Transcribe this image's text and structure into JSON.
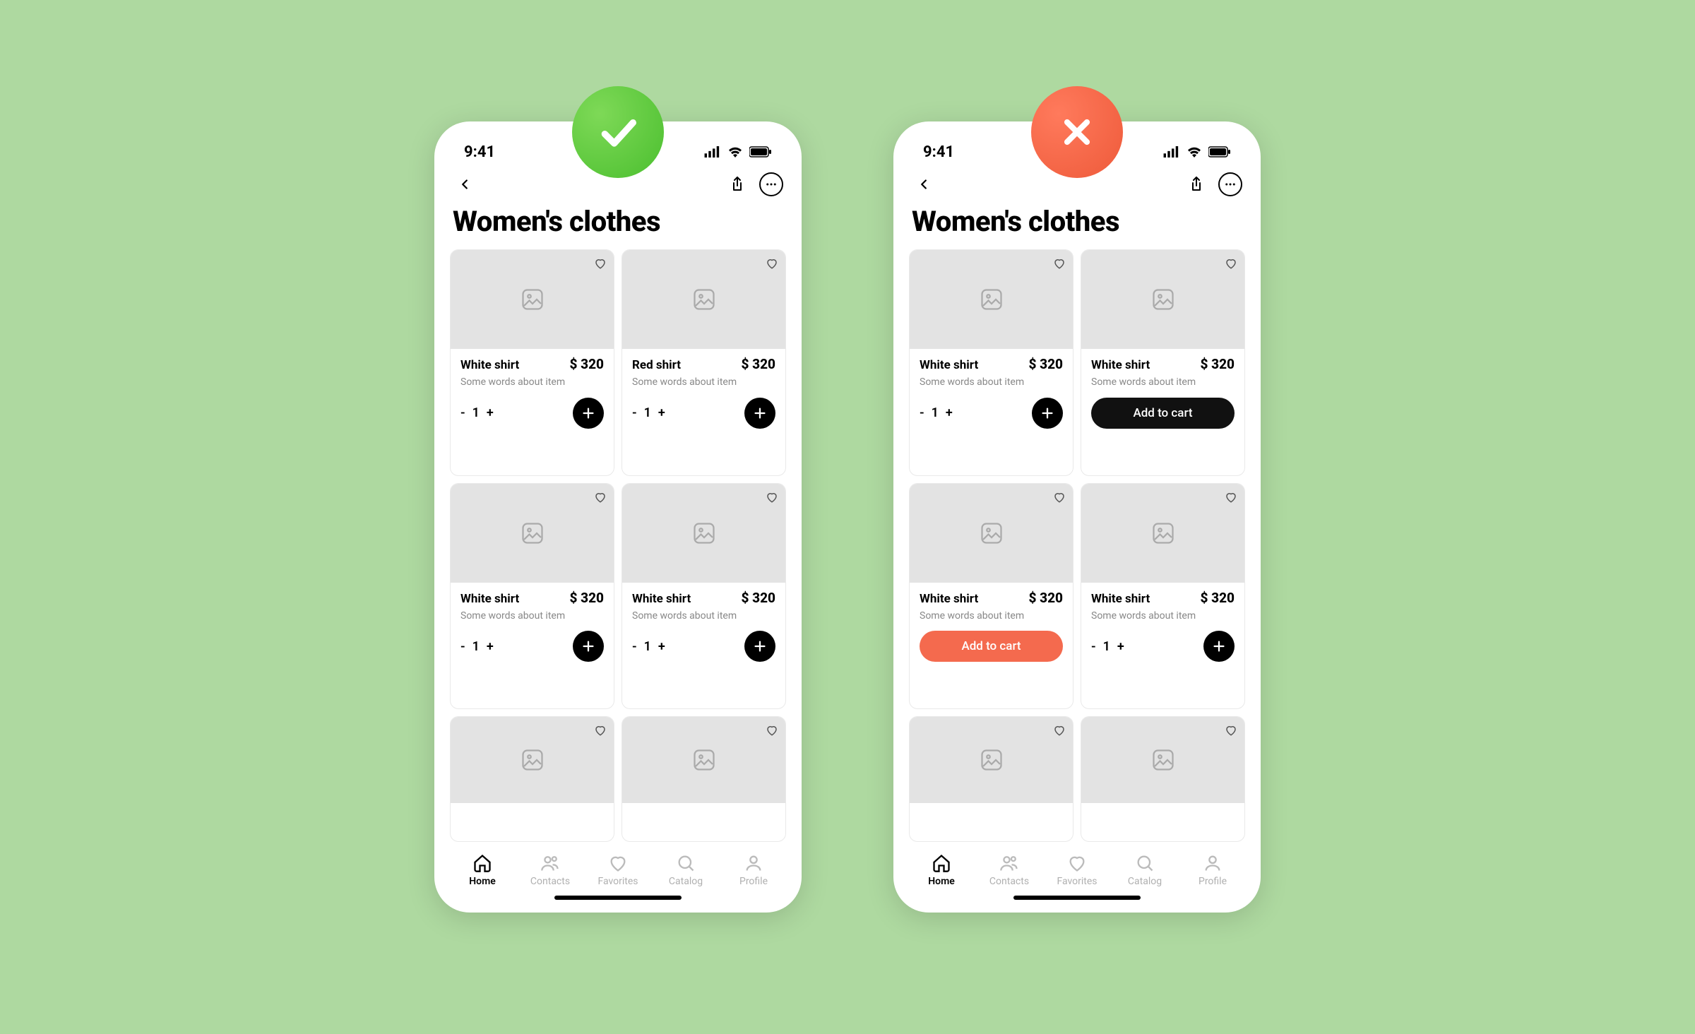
{
  "statusbar": {
    "time": "9:41"
  },
  "page_title": "Women's clothes",
  "add_to_cart_label": "Add to cart",
  "tabs": [
    {
      "label": "Home"
    },
    {
      "label": "Contacts"
    },
    {
      "label": "Favorites"
    },
    {
      "label": "Catalog"
    },
    {
      "label": "Profile"
    }
  ],
  "good": {
    "products": [
      {
        "name": "White shirt",
        "price": "$ 320",
        "desc": "Some words about item",
        "qty": "1"
      },
      {
        "name": "Red shirt",
        "price": "$ 320",
        "desc": "Some words about item",
        "qty": "1"
      },
      {
        "name": "White shirt",
        "price": "$ 320",
        "desc": "Some words about item",
        "qty": "1"
      },
      {
        "name": "White shirt",
        "price": "$ 320",
        "desc": "Some words about item",
        "qty": "1"
      }
    ]
  },
  "bad": {
    "products": [
      {
        "name": "White shirt",
        "price": "$ 320",
        "desc": "Some words about item",
        "qty": "1",
        "action": "stepper"
      },
      {
        "name": "White shirt",
        "price": "$ 320",
        "desc": "Some words about item",
        "action": "add_black"
      },
      {
        "name": "White shirt",
        "price": "$ 320",
        "desc": "Some words about item",
        "action": "add_orange"
      },
      {
        "name": "White shirt",
        "price": "$ 320",
        "desc": "Some words about item",
        "qty": "1",
        "action": "stepper"
      }
    ]
  }
}
